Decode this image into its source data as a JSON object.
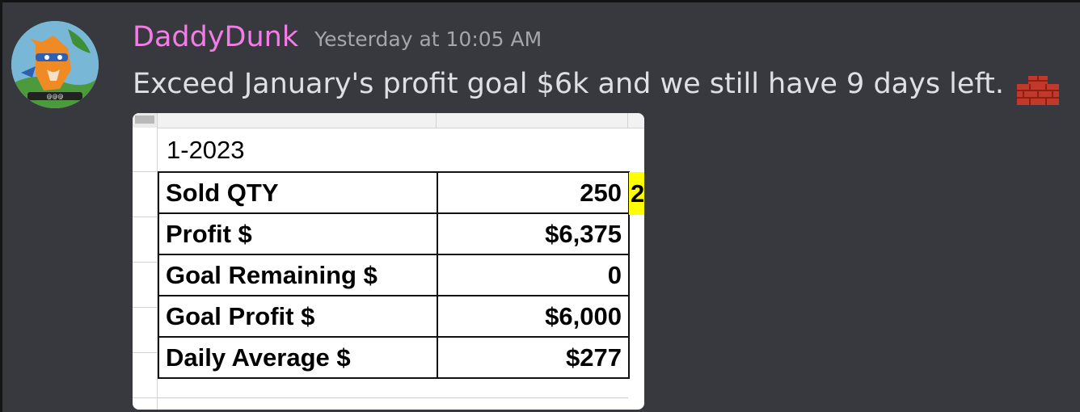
{
  "message": {
    "username": "DaddyDunk",
    "timestamp": "Yesterday at 10:05 AM",
    "content": "Exceed January's profit goal $6k and we still have 9 days left.",
    "emoji": "brick-emoji",
    "colors": {
      "username": "#f27de6",
      "background": "#37393f",
      "text": "#dde0e4",
      "timestamp": "#a3a6ab"
    }
  },
  "attachment": {
    "title": "1-2023",
    "rows": [
      {
        "label": "Sold QTY",
        "value": "250"
      },
      {
        "label": "Profit $",
        "value": "$6,375"
      },
      {
        "label": "Goal Remaining $",
        "value": "0"
      },
      {
        "label": "Goal Profit $",
        "value": "$6,000"
      },
      {
        "label": "Daily Average $",
        "value": "$277"
      }
    ],
    "clipped_cell": "2",
    "highlight_color": "#ffff00"
  }
}
